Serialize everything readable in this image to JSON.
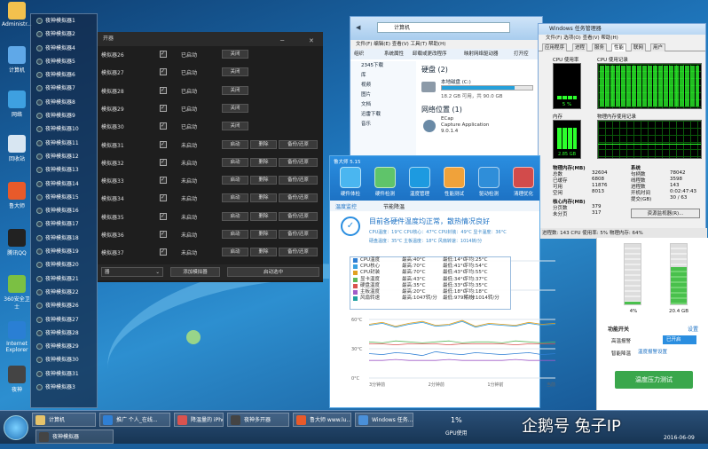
{
  "desktop_icons": [
    {
      "label": "Administr...",
      "color": "#f2c14e"
    },
    {
      "label": "计算机",
      "color": "#5fa8e8"
    },
    {
      "label": "网络",
      "color": "#3ea0e0"
    },
    {
      "label": "回收站",
      "color": "#d8e6f2"
    },
    {
      "label": "鲁大师",
      "color": "#e85a2a"
    },
    {
      "label": "腾讯QQ",
      "color": "#222222"
    },
    {
      "label": "360安全卫士",
      "color": "#7bc043"
    },
    {
      "label": "Internet Explorer",
      "color": "#2a7fd4"
    },
    {
      "label": "夜神",
      "color": "#444444"
    }
  ],
  "emulator_list": [
    "夜神模拟器1",
    "夜神模拟器2",
    "夜神模拟器4",
    "夜神模拟器5",
    "夜神模拟器6",
    "夜神模拟器7",
    "夜神模拟器8",
    "夜神模拟器9",
    "夜神模拟器10",
    "夜神模拟器11",
    "夜神模拟器12",
    "夜神模拟器13",
    "夜神模拟器14",
    "夜神模拟器15",
    "夜神模拟器16",
    "夜神模拟器17",
    "夜神模拟器18",
    "夜神模拟器19",
    "夜神模拟器20",
    "夜神模拟器21",
    "夜神模拟器22",
    "夜神模拟器26",
    "夜神模拟器27",
    "夜神模拟器28",
    "夜神模拟器29",
    "夜神模拟器30",
    "夜神模拟器31",
    "夜神模拟器3"
  ],
  "manager": {
    "title": "开器",
    "rows": [
      {
        "name": "模拟器26",
        "status": "已启动",
        "buttons": [
          "关闭"
        ]
      },
      {
        "name": "模拟器27",
        "status": "已启动",
        "buttons": [
          "关闭"
        ]
      },
      {
        "name": "模拟器28",
        "status": "已启动",
        "buttons": [
          "关闭"
        ]
      },
      {
        "name": "模拟器29",
        "status": "已启动",
        "buttons": [
          "关闭"
        ]
      },
      {
        "name": "模拟器30",
        "status": "已启动",
        "buttons": [
          "关闭"
        ]
      },
      {
        "name": "模拟器31",
        "status": "未启动",
        "buttons": [
          "启动",
          "删除",
          "备份/还原"
        ]
      },
      {
        "name": "模拟器32",
        "status": "未启动",
        "buttons": [
          "启动",
          "删除",
          "备份/还原"
        ]
      },
      {
        "name": "模拟器33",
        "status": "未启动",
        "buttons": [
          "启动",
          "删除",
          "备份/还原"
        ]
      },
      {
        "name": "模拟器34",
        "status": "未启动",
        "buttons": [
          "启动",
          "删除",
          "备份/还原"
        ]
      },
      {
        "name": "模拟器35",
        "status": "未启动",
        "buttons": [
          "启动",
          "删除",
          "备份/还原"
        ]
      },
      {
        "name": "模拟器36",
        "status": "未启动",
        "buttons": [
          "启动",
          "删除",
          "备份/还原"
        ]
      },
      {
        "name": "模拟器37",
        "status": "未启动",
        "buttons": [
          "启动",
          "删除",
          "备份/还原"
        ]
      }
    ],
    "footer": {
      "dropdown": "器",
      "add_button": "添加模拟器",
      "start_selected": "启动选中"
    }
  },
  "explorer": {
    "breadcrumb": "计算机",
    "menu": "文件(F)  编辑(E)  查看(V)  工具(T)  帮助(H)",
    "toolbar": [
      "组织",
      "系统属性",
      "卸载或更改程序",
      "映射网络驱动器",
      "打开控"
    ],
    "sidebar": [
      "2345下载",
      "库",
      "视频",
      "图片",
      "文档",
      "迅雷下载",
      "音乐"
    ],
    "hdd_section": "硬盘 (2)",
    "drive_name": "本地磁盘 (C:)",
    "drive_space": "18.2 GB 可用，共 90.0 GB",
    "drive_used_fraction": 0.8,
    "net_section": "网络位置 (1)",
    "net_item": [
      "ECap",
      "Capture Application",
      "9.0.1.4"
    ]
  },
  "taskmgr": {
    "title": "Windows 任务管理器",
    "menu": "文件(F)  选项(O)  查看(V)  帮助(H)",
    "tabs": [
      "应用程序",
      "进程",
      "服务",
      "性能",
      "联网",
      "用户"
    ],
    "cpu_label": "CPU 使用率",
    "cpu_value": "5 %",
    "cpu_hist": "CPU 使用记录",
    "mem_label": "内存",
    "mem_value": "2.85 GB",
    "mem_hist": "物理内存使用记录",
    "phys_title": "物理内存(MB)",
    "phys": [
      [
        "总数",
        "32604"
      ],
      [
        "已缓存",
        "6808"
      ],
      [
        "可用",
        "11876"
      ],
      [
        "空闲",
        "8013"
      ]
    ],
    "kernel_title": "核心内存(MB)",
    "kernel": [
      [
        "分页数",
        "379"
      ],
      [
        "未分页",
        "317"
      ]
    ],
    "system_title": "系统",
    "system": [
      [
        "句柄数",
        "78042"
      ],
      [
        "线程数",
        "3598"
      ],
      [
        "进程数",
        "143"
      ],
      [
        "开机时间",
        "0:02:47:43"
      ],
      [
        "提交(GB)",
        "30 / 63"
      ]
    ],
    "resmon_button": "资源监视器(R)...",
    "footer": "进程数: 143    CPU 使用率: 5%    物理内存: 64%"
  },
  "ludashi": {
    "title": "鲁大师 5.15",
    "tools": [
      {
        "label": "硬件体检",
        "color": "#4ab6f0"
      },
      {
        "label": "硬件检测",
        "color": "#5fc46a"
      },
      {
        "label": "温度管理",
        "color": "#1d9ae0"
      },
      {
        "label": "性能测试",
        "color": "#f0a23a"
      },
      {
        "label": "驱动检测",
        "color": "#2f8ed9"
      },
      {
        "label": "清理优化",
        "color": "#d24b4b"
      }
    ],
    "tabs": [
      "温度监控",
      "节能降温"
    ],
    "status_title": "目前各硬件温度均正常，散热情况良好",
    "status_line1": "CPU温度：19°C  CPU核心：47°C  CPU封装：49°C  显卡温度：36°C",
    "status_line2": "硬盘温度：35°C  主板温度：18°C  风扇转速：1014转/分",
    "y_labels": [
      "120°C",
      "90°C",
      "60°C",
      "30°C",
      "0°C"
    ],
    "x_labels": [
      "3分钟前",
      "2分钟前",
      "1分钟前",
      "当前"
    ],
    "legend": [
      {
        "name": "CPU温度",
        "max": "最高:40°C",
        "min": "最低:14°C",
        "avg": "平均:25°C",
        "color": "#2f7fd4"
      },
      {
        "name": "CPU核心",
        "max": "最高:70°C",
        "min": "最低:41°C",
        "avg": "平均:54°C",
        "color": "#3aa0e0"
      },
      {
        "name": "CPU封装",
        "max": "最高:70°C",
        "min": "最低:43°C",
        "avg": "平均:55°C",
        "color": "#e0a020"
      },
      {
        "name": "显卡温度",
        "max": "最高:43°C",
        "min": "最低:34°C",
        "avg": "平均:37°C",
        "color": "#5cb85c"
      },
      {
        "name": "硬盘温度",
        "max": "最高:35°C",
        "min": "最低:33°C",
        "avg": "平均:35°C",
        "color": "#d9534f"
      },
      {
        "name": "主板温度",
        "max": "最高:20°C",
        "min": "最低:18°C",
        "avg": "平均:18°C",
        "color": "#a05cc8"
      },
      {
        "name": "风扇转速",
        "max": "最高:1047转/分",
        "min": "最低:979转/分",
        "avg": "平均:1014转/分",
        "color": "#20a0a0"
      }
    ],
    "series": [
      {
        "key": "CPU温度",
        "color": "#2f7fd4",
        "values": [
          25,
          24,
          26,
          25,
          23,
          27,
          25,
          24,
          26,
          25,
          24,
          25,
          26,
          24,
          25
        ]
      },
      {
        "key": "CPU核心",
        "color": "#3aa0e0",
        "values": [
          54,
          56,
          52,
          55,
          57,
          53,
          54,
          58,
          52,
          55,
          54,
          53,
          56,
          54,
          55
        ]
      },
      {
        "key": "CPU封装",
        "color": "#e0a020",
        "values": [
          55,
          57,
          53,
          56,
          58,
          54,
          55,
          59,
          53,
          56,
          55,
          54,
          57,
          55,
          56
        ]
      },
      {
        "key": "显卡温度",
        "color": "#5cb85c",
        "values": [
          37,
          36,
          38,
          37,
          36,
          37,
          38,
          36,
          37,
          37,
          36,
          38,
          37,
          36,
          37
        ]
      },
      {
        "key": "硬盘温度",
        "color": "#d9534f",
        "values": [
          35,
          35,
          34,
          35,
          35,
          35,
          34,
          35,
          35,
          35,
          35,
          34,
          35,
          35,
          35
        ]
      },
      {
        "key": "主板温度",
        "color": "#a05cc8",
        "values": [
          18,
          18,
          19,
          18,
          18,
          18,
          19,
          18,
          18,
          18,
          18,
          19,
          18,
          18,
          18
        ]
      }
    ],
    "ylim": [
      0,
      120
    ]
  },
  "right_panel": {
    "gauges": [
      {
        "label": "4%",
        "fill": 0.04
      },
      {
        "label": "20.4 GB",
        "fill": 0.62
      }
    ],
    "func_switch": "功能开关",
    "settings": "设置",
    "alarm_label": "高温报警",
    "alarm_state": "已开启",
    "ai_label": "智能降温",
    "ai_link": "温度报警设置",
    "stress_button": "温度压力测试"
  },
  "taskbar": {
    "buttons": [
      {
        "label": "计算机",
        "color": "#e6c36a"
      },
      {
        "label": "推广 个人_在线...",
        "color": "#2f7fd4"
      },
      {
        "label": "降温量的 iPhone",
        "color": "#d9534f"
      },
      {
        "label": "夜神多开器",
        "color": "#444444"
      },
      {
        "label": "鲁大师 www.lu...",
        "color": "#e85a2a"
      },
      {
        "label": "Windows 任务...",
        "color": "#4a90d9"
      }
    ],
    "second_row": "夜神模拟器",
    "gpu_value": "1%",
    "gpu_label": "GPU使用",
    "date": "2016-06-09"
  },
  "watermark": "企鹅号 兔子IP"
}
